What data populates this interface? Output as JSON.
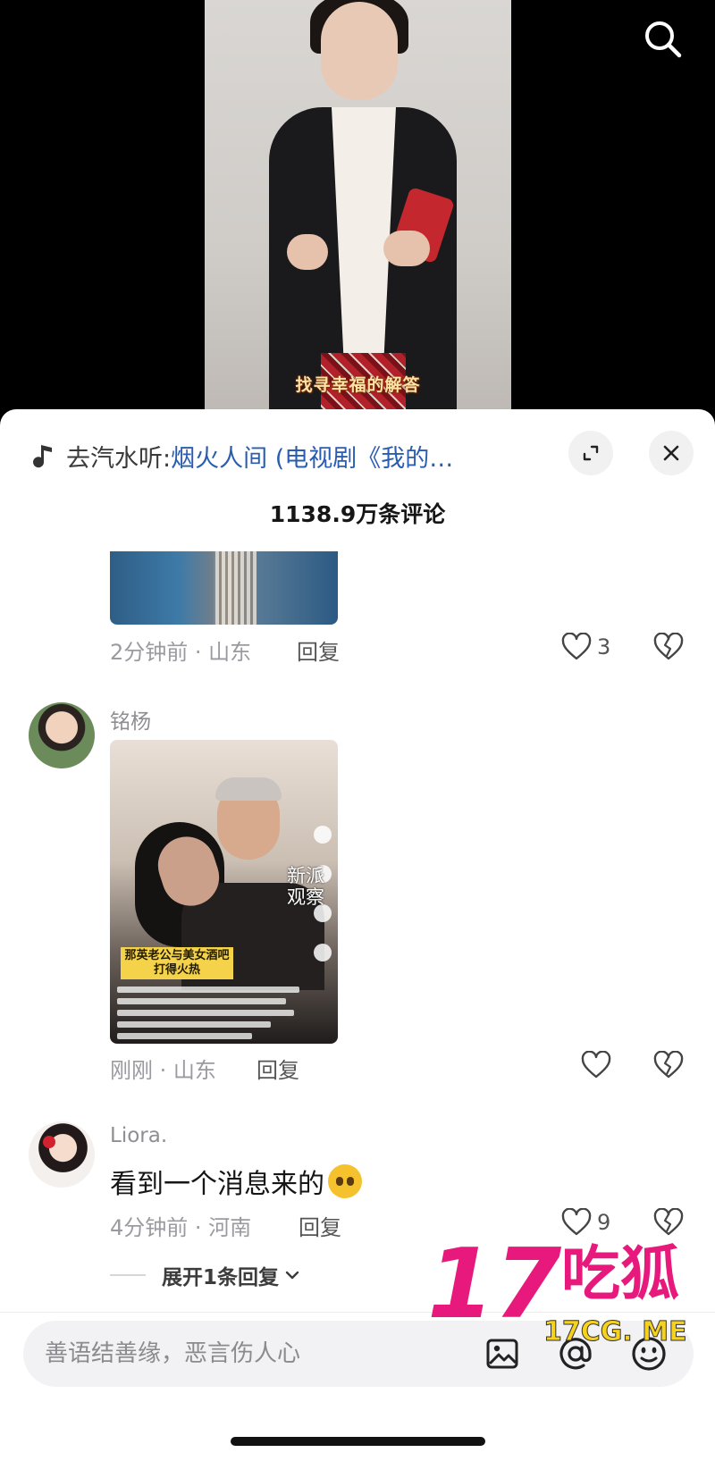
{
  "video": {
    "caption": "找寻幸福的解答"
  },
  "panel": {
    "music_prefix": "去汽水听:",
    "music_title": "烟火人间 (电视剧《我的…",
    "comment_count": "1138.9万条评论"
  },
  "comments": [
    {
      "time_location": "2分钟前 · 山东",
      "reply_label": "回复",
      "like_count": "3"
    },
    {
      "username": "铭杨",
      "thumbnail": {
        "logo_line1": "新派",
        "logo_line2": "观察",
        "caption": "那英老公与美女酒吧打得火热"
      },
      "time_location": "刚刚 · 山东",
      "reply_label": "回复",
      "like_count": ""
    },
    {
      "username": "Liora.",
      "text": "看到一个消息来的",
      "time_location": "4分钟前 · 河南",
      "reply_label": "回复",
      "like_count": "9",
      "expand_replies": "展开1条回复"
    }
  ],
  "input": {
    "placeholder": "善语结善缘，恶言伤人心"
  },
  "watermark": {
    "number": "17",
    "text": "吃狐",
    "url": "17CG. ME"
  },
  "colors": {
    "accent_link": "#2a5db0",
    "watermark_pink": "#e8197d",
    "watermark_yellow": "#f7d21c"
  }
}
